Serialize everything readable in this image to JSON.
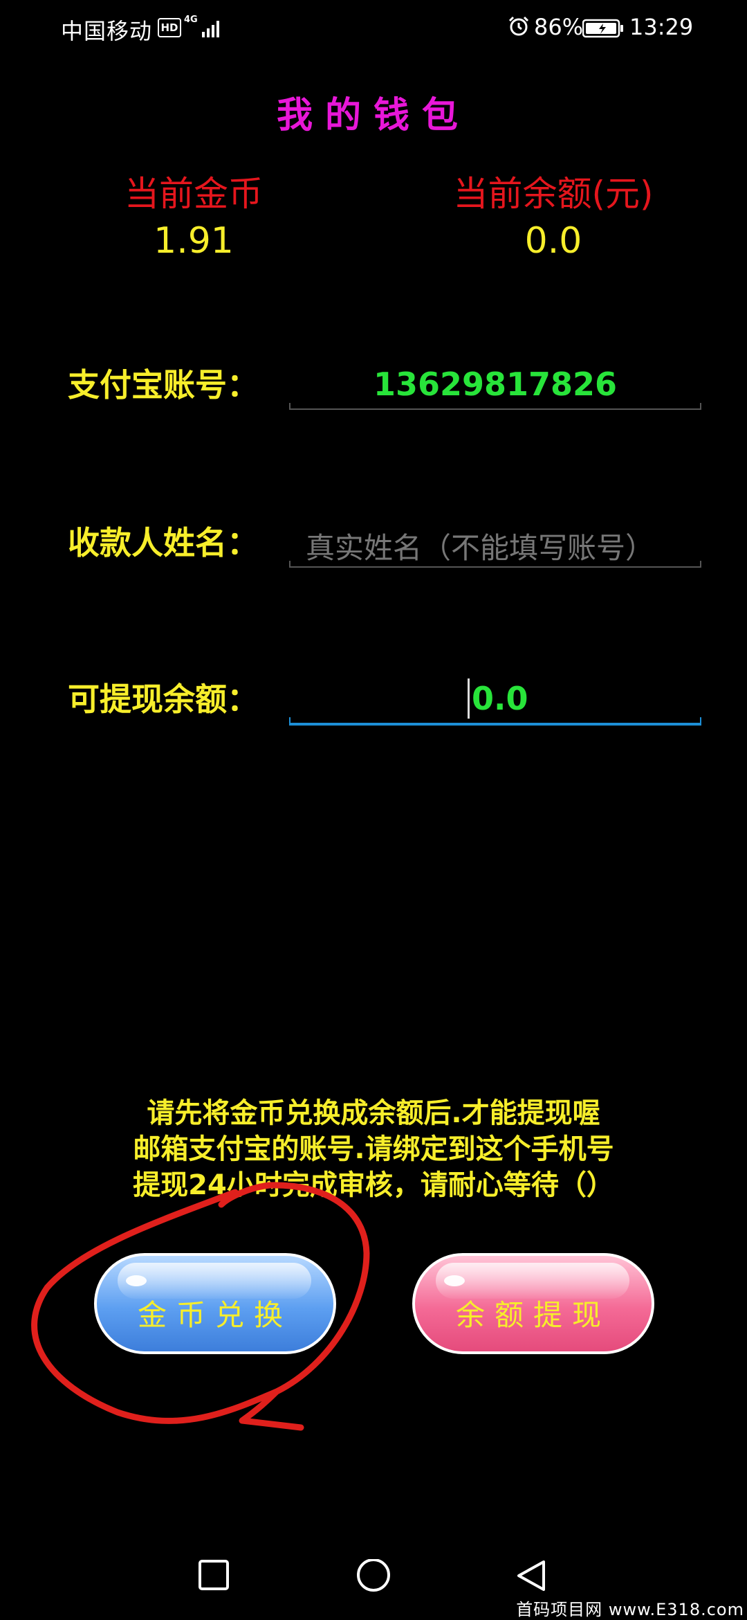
{
  "status_bar": {
    "carrier": "中国移动",
    "hd_badge": "HD",
    "network": "4G",
    "battery_percent": "86%",
    "time": "13:29",
    "icons": [
      "signal-icon",
      "alarm-icon",
      "battery-icon"
    ]
  },
  "page": {
    "title": "我的钱包"
  },
  "balance": {
    "coins_label": "当前金币",
    "coins_value": "1.91",
    "balance_label": "当前余额(元)",
    "balance_value": "0.0"
  },
  "form": {
    "alipay_label": "支付宝账号：",
    "alipay_value": "13629817826",
    "payee_label": "收款人姓名：",
    "payee_placeholder": "真实姓名（不能填写账号）",
    "payee_value": "",
    "withdrawable_label": "可提现余额：",
    "withdrawable_value": "0.0"
  },
  "notice": {
    "line1": "请先将金币兑换成余额后.才能提现喔",
    "line2": "邮箱支付宝的账号.请绑定到这个手机号",
    "line3": "提现24小时完成审核，请耐心等待（）"
  },
  "buttons": {
    "exchange_label": "金币兑换",
    "withdraw_label": "余额提现"
  },
  "nav": {
    "icons": [
      "recent-apps-icon",
      "home-icon",
      "back-icon"
    ]
  },
  "watermark": "首码项目网 www.E318.com",
  "colors": {
    "background": "#000000",
    "title": "#e817d8",
    "stat_label": "#e5161d",
    "yellow_text": "#f7ee2b",
    "green_value": "#28e43a",
    "focus_underline": "#1d8fd6",
    "annotation_red": "#e0201c"
  }
}
